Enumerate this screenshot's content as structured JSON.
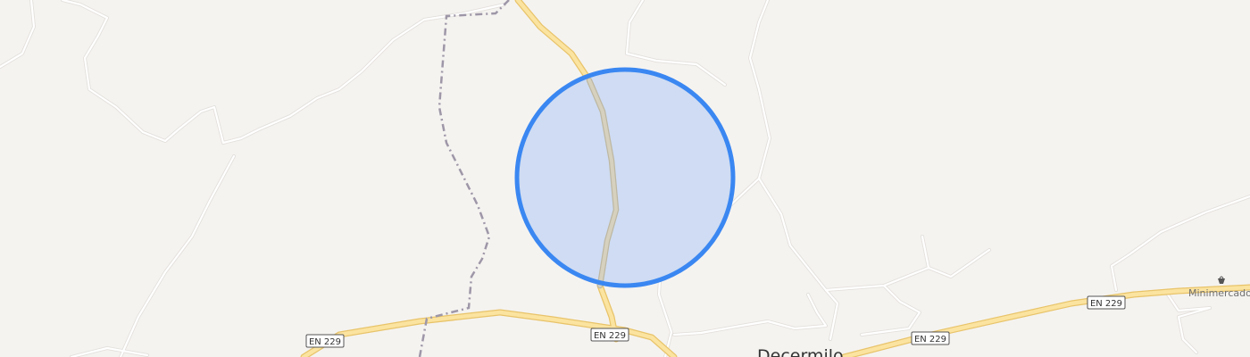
{
  "map": {
    "place_label": "Decermilo",
    "poi": {
      "label": "Minimercado",
      "icon": "basket-icon"
    },
    "road_shields": [
      "EN 229",
      "EN 229",
      "EN 229",
      "EN 229"
    ],
    "colors": {
      "background": "#f5f3f0",
      "minor_road": "#ffffff",
      "minor_road_casing": "#e3e0dc",
      "primary_road": "#fbe3a0",
      "primary_road_casing": "#e8c46a",
      "track": "#d6d0bf",
      "boundary": "#9e97a8",
      "accuracy_circle_fill": "#cfdcf3",
      "accuracy_circle_stroke": "#3a87f2"
    }
  }
}
